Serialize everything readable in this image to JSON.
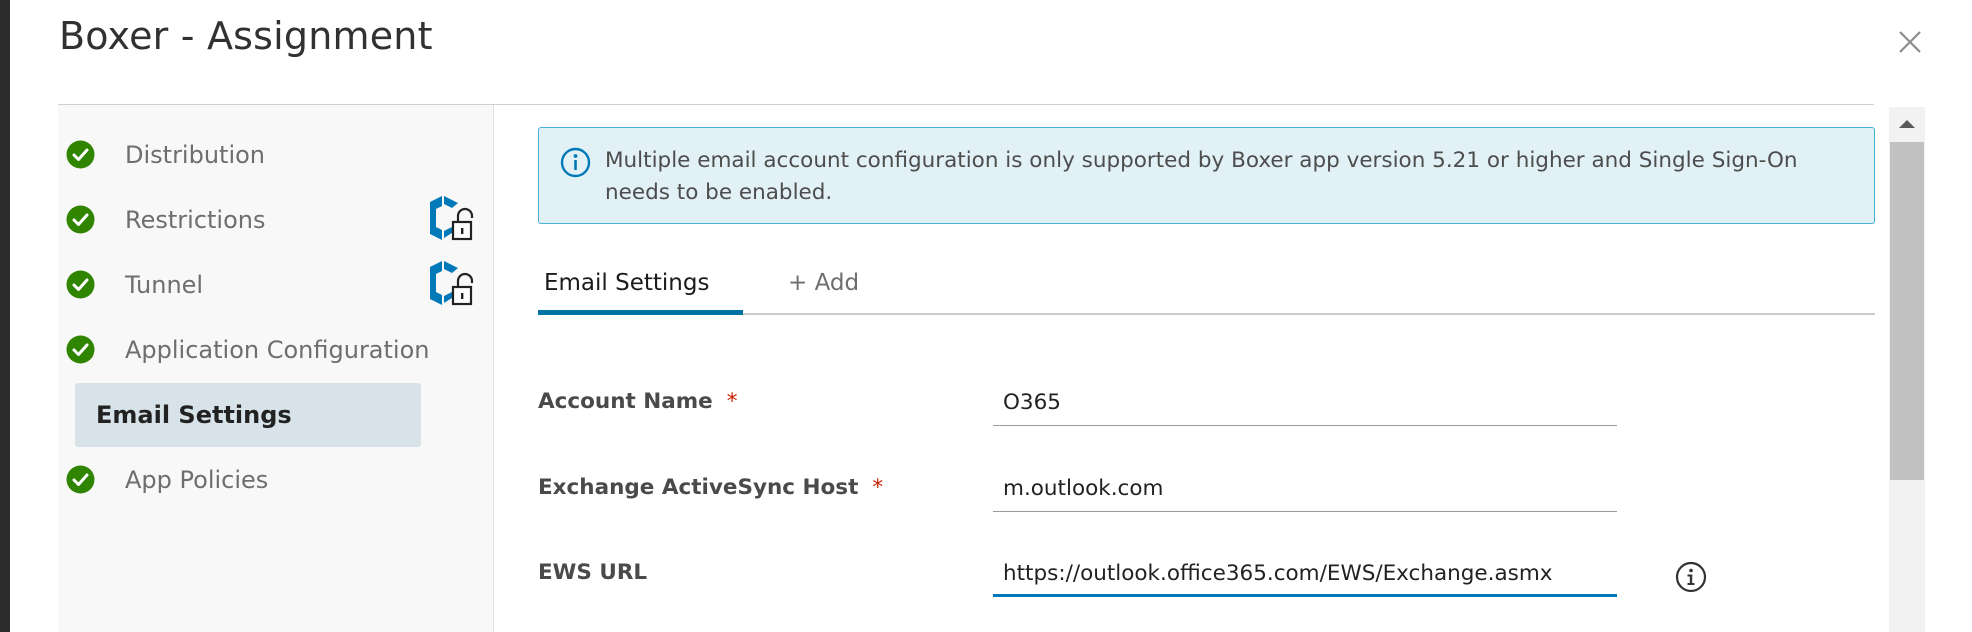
{
  "dialog": {
    "title": "Boxer - Assignment"
  },
  "sidebar": {
    "items": [
      {
        "label": "Distribution",
        "status": "complete",
        "locked": false
      },
      {
        "label": "Restrictions",
        "status": "complete",
        "locked": true
      },
      {
        "label": "Tunnel",
        "status": "complete",
        "locked": true
      },
      {
        "label": "Application Configuration",
        "status": "complete",
        "locked": false
      },
      {
        "label": "Email Settings",
        "status": "active",
        "locked": false
      },
      {
        "label": "App Policies",
        "status": "complete",
        "locked": false
      }
    ]
  },
  "alert": {
    "icon": "info-icon",
    "text": "Multiple email account configuration is only supported by Boxer app version 5.21 or higher and Single Sign-On needs to be enabled."
  },
  "tabs": [
    {
      "label": "Email Settings",
      "selected": true
    },
    {
      "label": "+ Add",
      "selected": false
    }
  ],
  "form": {
    "account_name": {
      "label": "Account Name",
      "required_mark": "*",
      "value": "O365"
    },
    "eas_host": {
      "label": "Exchange ActiveSync Host",
      "required_mark": "*",
      "value": "m.outlook.com"
    },
    "ews_url": {
      "label": "EWS URL",
      "value": "https://outlook.office365.com/EWS/Exchange.asmx"
    }
  },
  "colors": {
    "accent": "#0072a3",
    "success": "#2f8400",
    "required": "#c92100",
    "lock_icon": "#0079b8"
  }
}
